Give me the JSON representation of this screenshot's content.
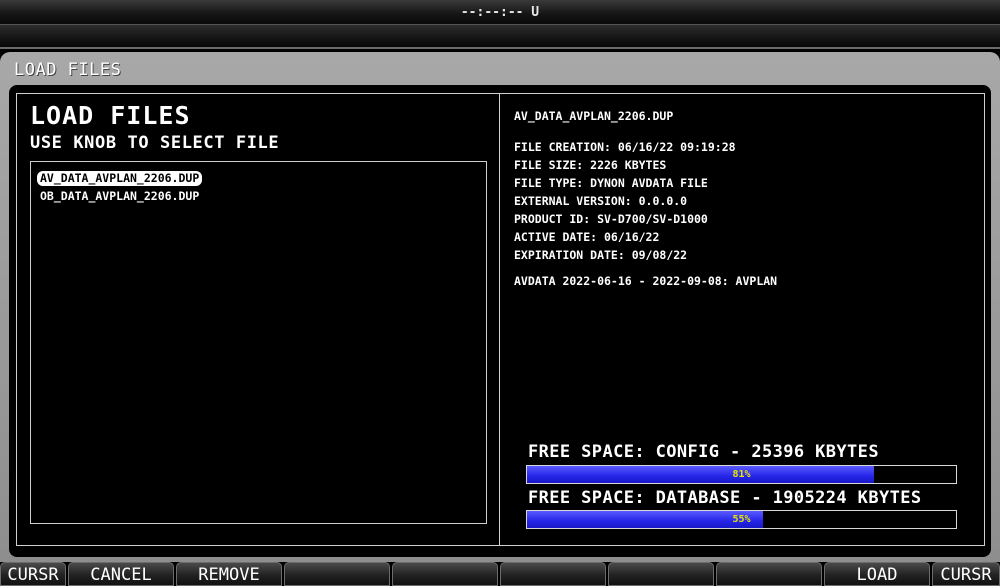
{
  "status_bar": {
    "time": "--:--:-- U"
  },
  "panel": {
    "title": "LOAD FILES"
  },
  "left": {
    "heading": "LOAD FILES",
    "instruction": "USE KNOB TO SELECT FILE",
    "files": [
      {
        "name": "AV_DATA_AVPLAN_2206.DUP",
        "selected": true
      },
      {
        "name": "OB_DATA_AVPLAN_2206.DUP",
        "selected": false
      }
    ]
  },
  "details": {
    "filename": "AV_DATA_AVPLAN_2206.DUP",
    "lines": [
      "FILE CREATION: 06/16/22 09:19:28",
      "FILE SIZE: 2226 KBYTES",
      "FILE TYPE: DYNON AVDATA FILE",
      "EXTERNAL VERSION: 0.0.0.0",
      "PRODUCT ID: SV-D700/SV-D1000",
      "ACTIVE DATE: 06/16/22",
      "EXPIRATION DATE: 09/08/22"
    ],
    "summary": "AVDATA 2022-06-16 - 2022-09-08: AVPLAN"
  },
  "free_space": {
    "config": {
      "label": "FREE SPACE: CONFIG - 25396 KBYTES",
      "percent": 81,
      "percent_label": "81%"
    },
    "database": {
      "label": "FREE SPACE: DATABASE - 1905224 KBYTES",
      "percent": 55,
      "percent_label": "55%"
    }
  },
  "softkeys": [
    "CURSR",
    "CANCEL",
    "REMOVE",
    "",
    "",
    "",
    "",
    "",
    "LOAD",
    "CURSR"
  ],
  "colors": {
    "bar_fill": "#2525e8",
    "percent_text": "#e6e600",
    "frame": "#9a9a9a"
  }
}
